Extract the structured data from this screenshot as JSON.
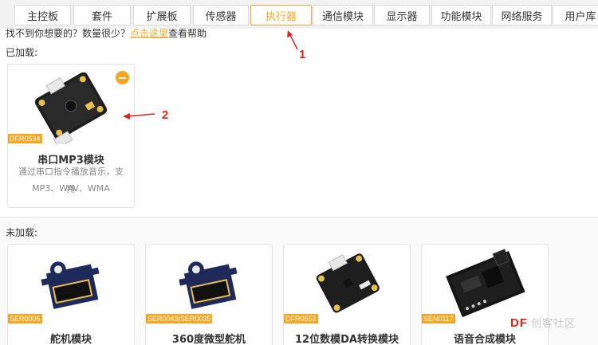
{
  "tabs": [
    {
      "label": "主控板"
    },
    {
      "label": "套件"
    },
    {
      "label": "扩展板"
    },
    {
      "label": "传感器"
    },
    {
      "label": "执行器"
    },
    {
      "label": "通信模块"
    },
    {
      "label": "显示器"
    },
    {
      "label": "功能模块"
    },
    {
      "label": "网络服务"
    },
    {
      "label": "用户库"
    }
  ],
  "active_tab": "执行器",
  "help": {
    "prefix": "找不到你想要的？数量很少？",
    "link": "点击这里",
    "suffix": "查看帮助"
  },
  "loaded": {
    "label": "已加载:",
    "items": [
      {
        "sku": "DFR0534",
        "name": "串口MP3模块",
        "desc_line1": "通过串口指令播放音乐，支持",
        "desc_line2": "MP3、WAV、WMA"
      }
    ]
  },
  "unloaded": {
    "label": "未加载:",
    "items": [
      {
        "sku": "SER0006",
        "name": "舵机模块"
      },
      {
        "sku": "SER0043|SER0035",
        "name": "360度微型舵机"
      },
      {
        "sku": "DFR0552",
        "name": "12位数模DA转换模块"
      },
      {
        "sku": "SEN0117",
        "name": "语音合成模块"
      }
    ]
  },
  "annotations": {
    "one": "1",
    "two": "2"
  },
  "watermark": {
    "brand": "DF",
    "text": "创客社区"
  },
  "colors": {
    "accent": "#f5a623",
    "annotation": "#d9241c"
  }
}
